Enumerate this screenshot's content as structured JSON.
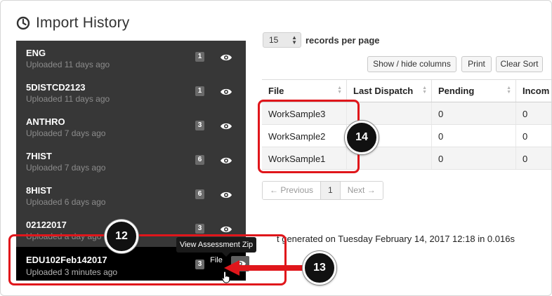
{
  "title": "Import History",
  "colors": {
    "highlight": "#e0161b",
    "list_bg": "#373737",
    "active_bg": "#000000"
  },
  "imports": [
    {
      "name": "ENG",
      "uploaded": "Uploaded 11 days ago",
      "count": "1"
    },
    {
      "name": "5DISTCD2123",
      "uploaded": "Uploaded 11 days ago",
      "count": "1"
    },
    {
      "name": "ANTHRO",
      "uploaded": "Uploaded 7 days ago",
      "count": "3"
    },
    {
      "name": "7HIST",
      "uploaded": "Uploaded 7 days ago",
      "count": "6"
    },
    {
      "name": "8HIST",
      "uploaded": "Uploaded 6 days ago",
      "count": "6"
    },
    {
      "name": "02122017",
      "uploaded": "Uploaded a day ago",
      "count": "3"
    },
    {
      "name": "EDU102Feb142017",
      "uploaded": "Uploaded 3 minutes ago",
      "count": "3"
    }
  ],
  "tooltip": "View Assessment Zip File",
  "records_per_page": {
    "value": "15",
    "label": "records per page"
  },
  "buttons": {
    "show_hide": "Show / hide columns",
    "print": "Print",
    "clear_sort": "Clear Sort"
  },
  "table": {
    "headers": [
      "File",
      "Last Dispatch",
      "Pending",
      "Incom"
    ],
    "rows": [
      [
        "WorkSample3",
        "",
        "0",
        "0"
      ],
      [
        "WorkSample2",
        "",
        "0",
        "0"
      ],
      [
        "WorkSample1",
        "",
        "0",
        "0"
      ]
    ]
  },
  "pagination": {
    "previous": "← Previous",
    "page": "1",
    "next": "Next →"
  },
  "footer": "t generated on Tuesday February 14, 2017 12:18 in 0.016s",
  "callouts": {
    "c12": "12",
    "c13": "13",
    "c14": "14"
  }
}
